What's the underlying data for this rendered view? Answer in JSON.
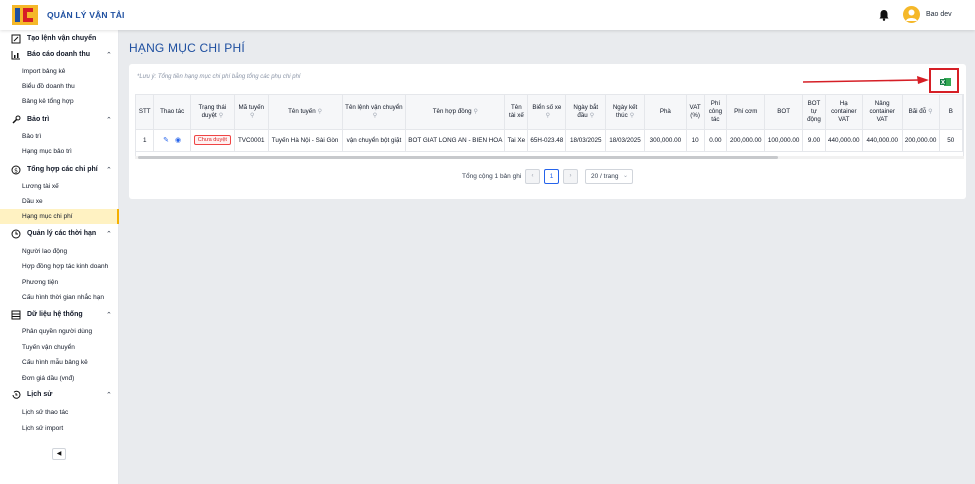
{
  "header": {
    "app_title": "QUẢN LÝ VẬN TẢI",
    "user_name": "Bao dev",
    "brand_color": "#1e4fa0"
  },
  "sidebar": {
    "groups": [
      {
        "label": "Tạo lệnh vận chuyển",
        "icon": "edit-document-icon",
        "items": []
      },
      {
        "label": "Báo cáo doanh thu",
        "icon": "chart-icon",
        "items": [
          "Import bảng kê",
          "Biểu đồ doanh thu",
          "Bảng kê tổng hợp"
        ]
      },
      {
        "label": "Bảo trì",
        "icon": "wrench-icon",
        "items": [
          "Bảo trì",
          "Hạng mục bảo trì"
        ]
      },
      {
        "label": "Tổng hợp các chi phí",
        "icon": "dollar-icon",
        "items": [
          "Lương tài xế",
          "Dầu xe",
          "Hạng mục chi phí"
        ]
      },
      {
        "label": "Quản lý các thời hạn",
        "icon": "clock-icon",
        "items": [
          "Người lao động",
          "Hợp đồng hợp tác kinh doanh",
          "Phương tiện",
          "Cấu hình thời gian nhắc hạn"
        ]
      },
      {
        "label": "Dữ liệu hệ thống",
        "icon": "database-icon",
        "items": [
          "Phân quyền người dùng",
          "Tuyến vận chuyển",
          "Cấu hình mẫu bảng kê",
          "Đơn giá dầu (vnđ)"
        ]
      },
      {
        "label": "Lịch sử",
        "icon": "history-icon",
        "items": [
          "Lịch sử thao tác",
          "Lịch sử import"
        ]
      }
    ],
    "active_item": "Hạng mục chi phí",
    "active_color": "#f5b000"
  },
  "page": {
    "title": "HẠNG MỤC CHI PHÍ",
    "note": "*Lưu ý: Tổng tiền hạng mục chi phí bằng tổng các phụ chi phí"
  },
  "table": {
    "columns": [
      "STT",
      "Thao tác",
      "Trạng thái duyệt",
      "Mã tuyến",
      "Tên tuyến",
      "Tên lệnh vận chuyển",
      "Tên hợp đồng",
      "Tên tài xế",
      "Biển số xe",
      "Ngày bắt đầu",
      "Ngày kết thúc",
      "Phà",
      "VAT (%)",
      "Phí công tác",
      "Phí cơm",
      "BOT",
      "BOT tự động",
      "Hạ container VAT",
      "Nâng container VAT",
      "Bãi đỗ",
      "B"
    ],
    "rows": [
      {
        "stt": "1",
        "status": "Chưa duyệt",
        "route_code": "TVC0001",
        "route_name": "Tuyến Hà Nội - Sài Gòn",
        "order_name": "vận chuyển bột giặt",
        "contract_name": "BOT GIAT LONG AN - BIEN HOA",
        "driver": "Tai Xe",
        "plate": "65H-023.48",
        "start_date": "18/03/2025",
        "end_date": "18/03/2025",
        "ferry": "300,000.00",
        "vat": "10",
        "work_fee": "0.00",
        "meal_fee": "200,000.00",
        "bot": "100,000.00",
        "bot_auto": "9.00",
        "lower_container": "440,000.00",
        "lift_container": "440,000.00",
        "parking": "200,000.00",
        "extra": "50"
      }
    ]
  },
  "pagination": {
    "total": "Tổng cộng 1 bản ghi",
    "current_page": "1",
    "page_size": "20 / trang",
    "prev": "‹",
    "next": "›"
  },
  "status_color": "#dc2626",
  "highlight_color": "#d61f26"
}
